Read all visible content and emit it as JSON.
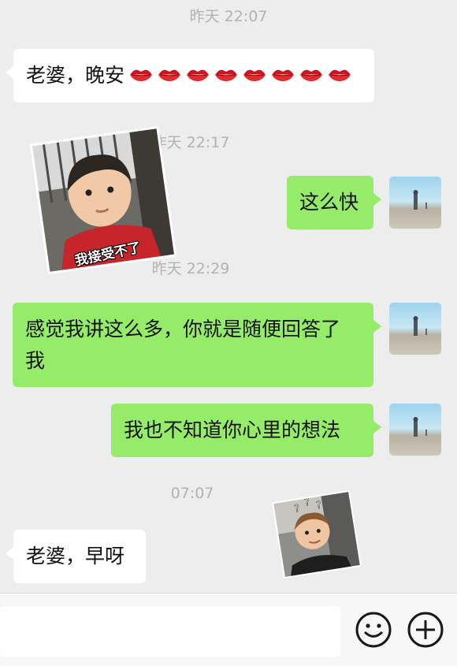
{
  "timestamps": [
    "昨天 22:07",
    "昨天 22:17",
    "昨天 22:29",
    "07:07"
  ],
  "messages": {
    "m1_text": "老婆，晚安",
    "m2_sticker_caption": "我接受不了",
    "m3_text": "这么快",
    "m4_line1": "感觉我讲这么多，你就是随便回答了",
    "m4_line2": "我",
    "m5_text": "我也不知道你心里的想法",
    "m6_text": "老婆，早呀"
  },
  "emoji": {
    "kiss_lips_count": 8,
    "kiss_icon": "kiss-lips-icon"
  },
  "colors": {
    "background": "#ededed",
    "incoming_bubble": "#ffffff",
    "outgoing_bubble": "#95ec69",
    "timestamp": "#b2b2b2"
  },
  "icons": {
    "emoji_button": "smiley-icon",
    "more_button": "plus-circle-icon"
  }
}
